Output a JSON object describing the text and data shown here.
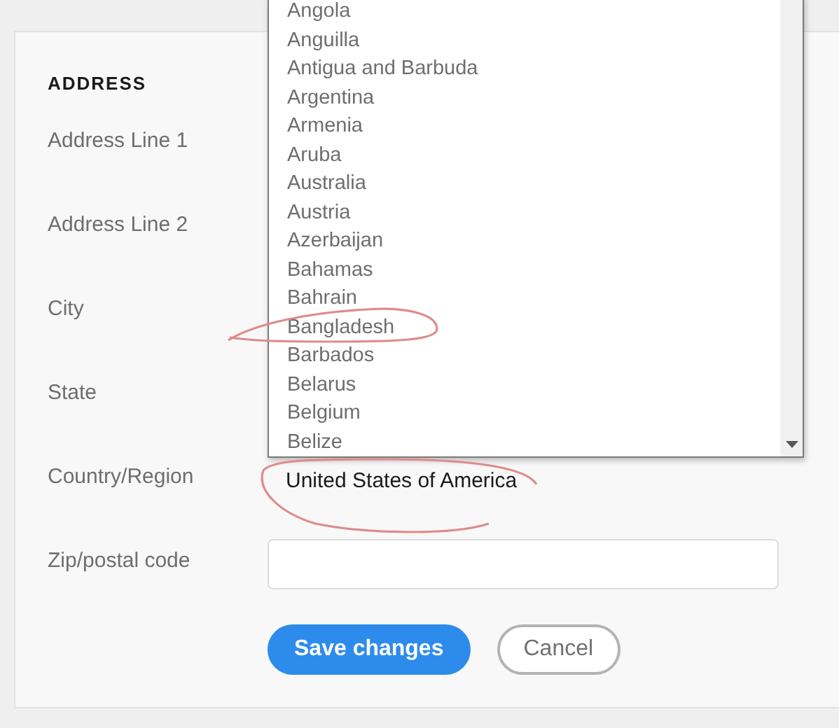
{
  "section_title": "ADDRESS",
  "fields": [
    {
      "label": "Address Line 1",
      "kind": "hidden"
    },
    {
      "label": "Address Line 2",
      "kind": "hidden"
    },
    {
      "label": "City",
      "kind": "hidden"
    },
    {
      "label": "State",
      "kind": "hidden"
    },
    {
      "label": "Country/Region",
      "kind": "select",
      "value": "United States of America"
    },
    {
      "label": "Zip/postal code",
      "kind": "text"
    }
  ],
  "dropdown_options": [
    "Angola",
    "Anguilla",
    "Antigua and Barbuda",
    "Argentina",
    "Armenia",
    "Aruba",
    "Australia",
    "Austria",
    "Azerbaijan",
    "Bahamas",
    "Bahrain",
    "Bangladesh",
    "Barbados",
    "Belarus",
    "Belgium",
    "Belize"
  ],
  "buttons": [
    {
      "label": "Save changes",
      "kind": "primary"
    },
    {
      "label": "Cancel",
      "kind": "secondary"
    }
  ]
}
